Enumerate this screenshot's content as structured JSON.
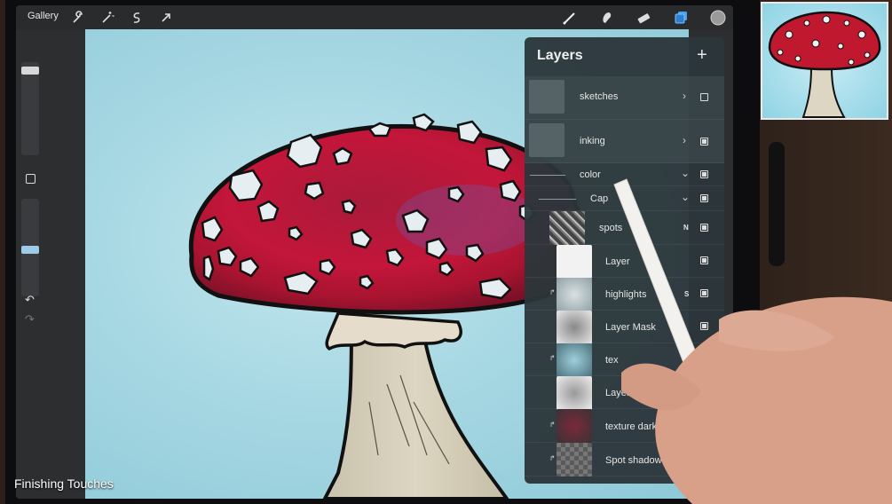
{
  "toolbar": {
    "gallery_label": "Gallery",
    "left_icons": [
      "wrench-icon",
      "magic-wand-icon",
      "selection-icon",
      "transform-arrow-icon"
    ],
    "right_icons": [
      "brush-icon",
      "smudge-icon",
      "eraser-icon",
      "layers-icon",
      "color-swatch-icon"
    ]
  },
  "layers_panel": {
    "title": "Layers",
    "add_symbol": "+",
    "rows": [
      {
        "name": "sketches",
        "expand": "›",
        "visible": false
      },
      {
        "name": "inking",
        "expand": "›",
        "visible": true
      },
      {
        "name": "color",
        "expand": "⌄",
        "visible": true
      },
      {
        "name": "Cap",
        "expand": "⌄",
        "visible": true
      },
      {
        "name": "spots",
        "mode": "N",
        "visible": true
      },
      {
        "name": "Layer",
        "visible": true
      },
      {
        "name": "highlights",
        "mode": "S",
        "visible": true
      },
      {
        "name": "Layer Mask",
        "visible": true
      },
      {
        "name": "tex",
        "visible": true
      },
      {
        "name": "Layer",
        "visible": true
      },
      {
        "name": "texture dark",
        "visible": true
      },
      {
        "name": "Spot shadows",
        "visible": true
      }
    ]
  },
  "caption": "Finishing Touches",
  "colors": {
    "accent_blue": "#4aa3f0",
    "cap_red": "#c0182f",
    "background_sky": "#a7d8e3"
  }
}
